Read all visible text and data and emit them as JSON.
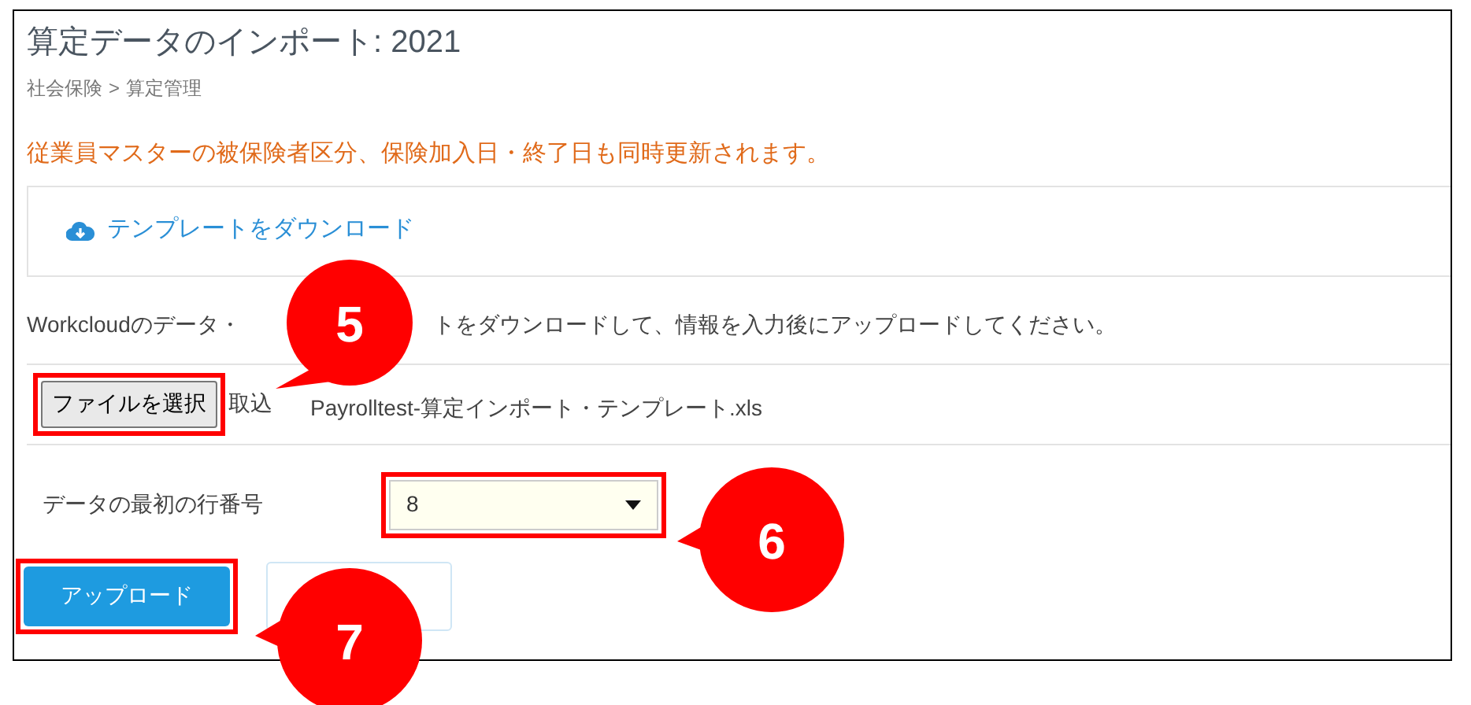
{
  "title": "算定データのインポート: 2021",
  "breadcrumb": [
    "社会保険",
    "算定管理"
  ],
  "breadcrumb_separator": ">",
  "notice": "従業員マスターの被保険者区分、保険加入日・終了日も同時更新されます。",
  "template_link": "テンプレートをダウンロード",
  "instruction_parts": [
    "Workcloudのデータ・",
    "トをダウンロードして、情報を入力後にアップロードしてください。"
  ],
  "file_button": "ファイルを選択",
  "file_label": "取込",
  "file_name": "Payrolltest-算定インポート・テンプレート.xls",
  "row_field": {
    "label": "データの最初の行番号",
    "value": "8"
  },
  "upload_button": "アップロード",
  "callouts": [
    "5",
    "6",
    "7"
  ]
}
